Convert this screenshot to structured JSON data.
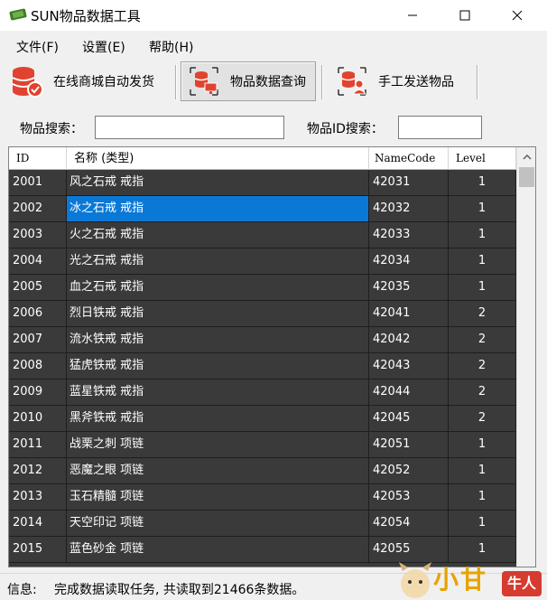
{
  "window": {
    "title": "SUN物品数据工具",
    "minimize_icon": "minimize-icon",
    "maximize_icon": "maximize-icon",
    "close_icon": "close-icon"
  },
  "menu": [
    "文件(F)",
    "设置(E)",
    "帮助(H)"
  ],
  "toolbar": {
    "buttons": [
      {
        "label": "在线商城自动发货",
        "icon": "database-check-icon",
        "active": false
      },
      {
        "label": "物品数据查询",
        "icon": "database-monitor-icon",
        "active": true
      },
      {
        "label": "手工发送物品",
        "icon": "database-user-icon",
        "active": false
      }
    ]
  },
  "search": {
    "name_label": "物品搜索：",
    "name_value": "",
    "id_label": "物品ID搜索：",
    "id_value": ""
  },
  "grid": {
    "columns": [
      "ID",
      "名称 (类型)",
      "NameCode",
      "Level"
    ],
    "selected_row": 1,
    "rows": [
      {
        "id": "2001",
        "name": "风之石戒 戒指",
        "code": "42031",
        "level": "1"
      },
      {
        "id": "2002",
        "name": "冰之石戒 戒指",
        "code": "42032",
        "level": "1"
      },
      {
        "id": "2003",
        "name": "火之石戒 戒指",
        "code": "42033",
        "level": "1"
      },
      {
        "id": "2004",
        "name": "光之石戒 戒指",
        "code": "42034",
        "level": "1"
      },
      {
        "id": "2005",
        "name": "血之石戒 戒指",
        "code": "42035",
        "level": "1"
      },
      {
        "id": "2006",
        "name": "烈日铁戒 戒指",
        "code": "42041",
        "level": "2"
      },
      {
        "id": "2007",
        "name": "流水铁戒 戒指",
        "code": "42042",
        "level": "2"
      },
      {
        "id": "2008",
        "name": "猛虎铁戒 戒指",
        "code": "42043",
        "level": "2"
      },
      {
        "id": "2009",
        "name": "蓝星铁戒 戒指",
        "code": "42044",
        "level": "2"
      },
      {
        "id": "2010",
        "name": "黑斧铁戒 戒指",
        "code": "42045",
        "level": "2"
      },
      {
        "id": "2011",
        "name": "战栗之刺 项链",
        "code": "42051",
        "level": "1"
      },
      {
        "id": "2012",
        "name": "恶魔之眼 项链",
        "code": "42052",
        "level": "1"
      },
      {
        "id": "2013",
        "name": "玉石精髓 项链",
        "code": "42053",
        "level": "1"
      },
      {
        "id": "2014",
        "name": "天空印记 项链",
        "code": "42054",
        "level": "1"
      },
      {
        "id": "2015",
        "name": "蓝色砂金 项链",
        "code": "42055",
        "level": "1"
      }
    ]
  },
  "status": {
    "label": "信息:",
    "text": "完成数据读取任务, 共读取到21466条数据。"
  },
  "watermark": {
    "text": "小甘",
    "badge": "牛人"
  },
  "colors": {
    "grid_bg": "#3a3a3a",
    "selection": "#0a78d7",
    "icon_red": "#e0432f"
  }
}
